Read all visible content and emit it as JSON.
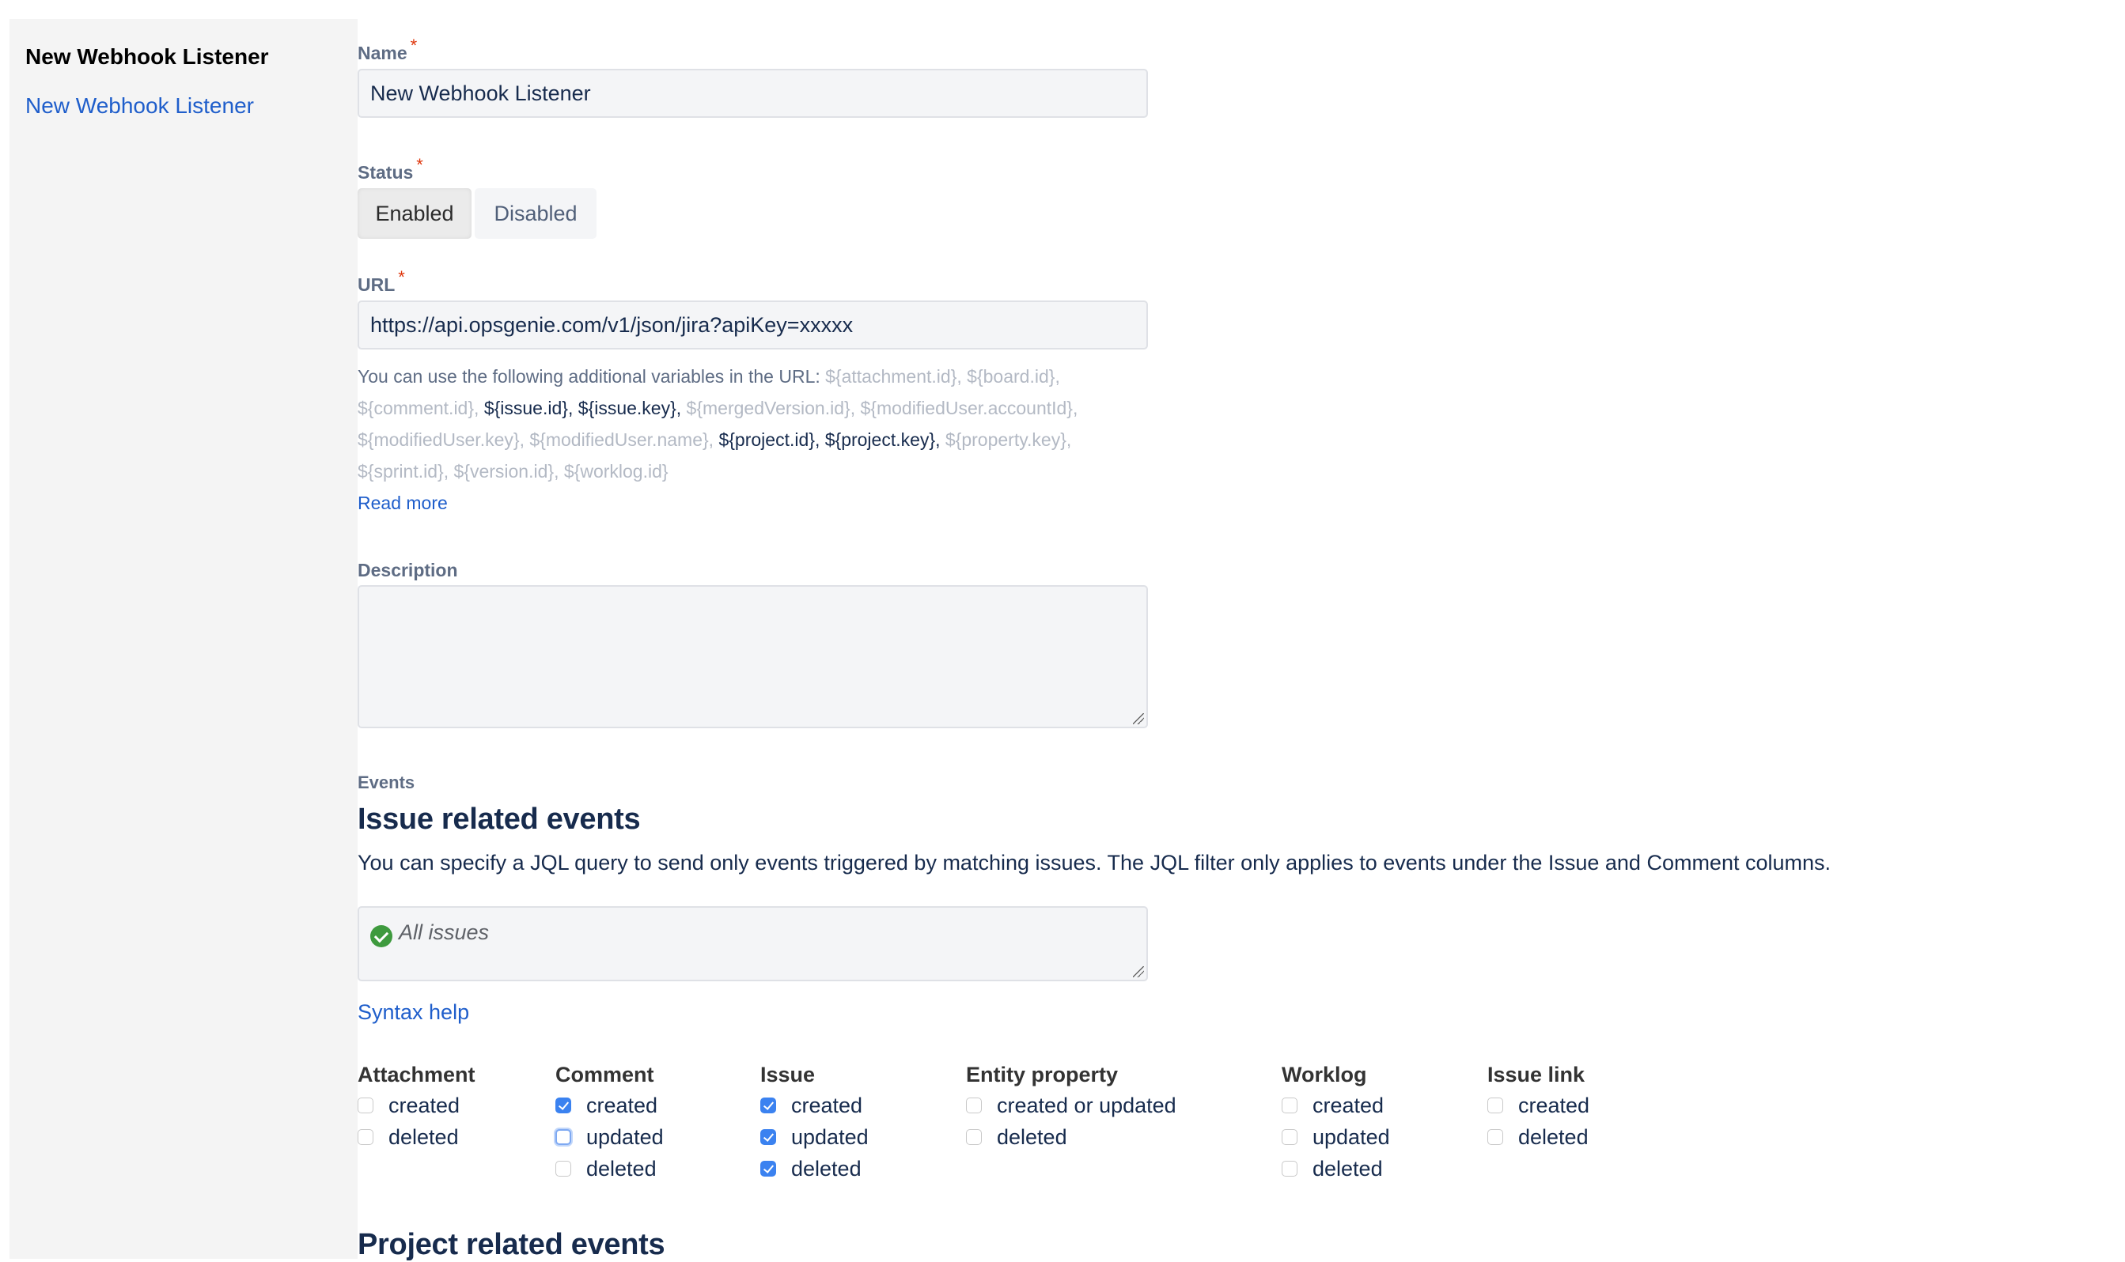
{
  "sidebar": {
    "title": "New Webhook Listener",
    "items": [
      {
        "label": "New Webhook Listener"
      }
    ]
  },
  "form": {
    "name": {
      "label": "Name",
      "required_mark": "*",
      "value": "New Webhook Listener"
    },
    "status": {
      "label": "Status",
      "required_mark": "*",
      "options": [
        {
          "label": "Enabled",
          "selected": true
        },
        {
          "label": "Disabled",
          "selected": false
        }
      ]
    },
    "url": {
      "label": "URL",
      "required_mark": "*",
      "value": "https://api.opsgenie.com/v1/json/jira?apiKey=xxxxx",
      "help_intro": "You can use the following additional variables in the URL:",
      "variables": [
        {
          "text": "${attachment.id}",
          "active": false
        },
        {
          "text": "${board.id}",
          "active": false
        },
        {
          "text": "${comment.id}",
          "active": false
        },
        {
          "text": "${issue.id}",
          "active": true
        },
        {
          "text": "${issue.key}",
          "active": true
        },
        {
          "text": "${mergedVersion.id}",
          "active": false
        },
        {
          "text": "${modifiedUser.accountId}",
          "active": false
        },
        {
          "text": "${modifiedUser.key}",
          "active": false
        },
        {
          "text": "${modifiedUser.name}",
          "active": false
        },
        {
          "text": "${project.id}",
          "active": true
        },
        {
          "text": "${project.key}",
          "active": true
        },
        {
          "text": "${property.key}",
          "active": false
        },
        {
          "text": "${sprint.id}",
          "active": false
        },
        {
          "text": "${version.id}",
          "active": false
        },
        {
          "text": "${worklog.id}",
          "active": false
        }
      ],
      "read_more": "Read more"
    },
    "description": {
      "label": "Description",
      "value": ""
    },
    "events": {
      "label": "Events",
      "issue_heading": "Issue related events",
      "issue_text": "You can specify a JQL query to send only events triggered by matching issues. The JQL filter only applies to events under the Issue and Comment columns.",
      "jql": {
        "icon": "check-circle-icon",
        "icon_color": "#3e9a3e",
        "value": "All issues"
      },
      "syntax_help": "Syntax help",
      "columns": [
        {
          "title": "Attachment",
          "options": [
            {
              "label": "created",
              "checked": false
            },
            {
              "label": "deleted",
              "checked": false
            }
          ]
        },
        {
          "title": "Comment",
          "options": [
            {
              "label": "created",
              "checked": true
            },
            {
              "label": "updated",
              "checked": false,
              "focused": true
            },
            {
              "label": "deleted",
              "checked": false
            }
          ]
        },
        {
          "title": "Issue",
          "options": [
            {
              "label": "created",
              "checked": true
            },
            {
              "label": "updated",
              "checked": true
            },
            {
              "label": "deleted",
              "checked": true
            }
          ]
        },
        {
          "title": "Entity property",
          "options": [
            {
              "label": "created or updated",
              "checked": false
            },
            {
              "label": "deleted",
              "checked": false
            }
          ]
        },
        {
          "title": "Worklog",
          "options": [
            {
              "label": "created",
              "checked": false
            },
            {
              "label": "updated",
              "checked": false
            },
            {
              "label": "deleted",
              "checked": false
            }
          ]
        },
        {
          "title": "Issue link",
          "options": [
            {
              "label": "created",
              "checked": false
            },
            {
              "label": "deleted",
              "checked": false
            }
          ]
        }
      ],
      "project_heading": "Project related events"
    }
  },
  "colors": {
    "accent": "#1f5ecb",
    "checkbox_checked": "#3b82f0",
    "required": "#de350b",
    "label": "#5e6c84",
    "text": "#172b4d",
    "sidebar_bg": "#f4f4f4",
    "input_bg": "#f4f5f7"
  }
}
